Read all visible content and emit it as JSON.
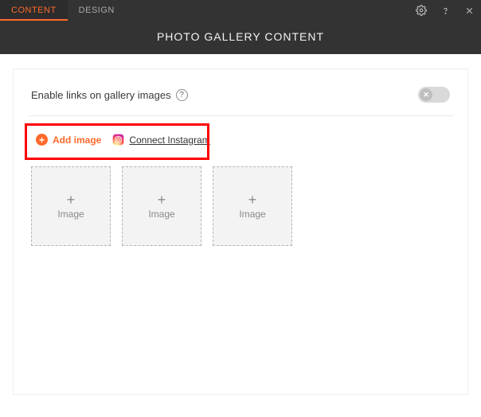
{
  "tabs": {
    "content": "CONTENT",
    "design": "DESIGN"
  },
  "title": "PHOTO GALLERY CONTENT",
  "options": {
    "enable_links_label": "Enable links on gallery images",
    "toggle_on": false
  },
  "actions": {
    "add_image_label": "Add image",
    "connect_instagram_label": "Connect Instagram"
  },
  "placeholders": {
    "image_label": "Image"
  },
  "thumbnails": [
    {
      "label_key": "placeholders.image_label"
    },
    {
      "label_key": "placeholders.image_label"
    },
    {
      "label_key": "placeholders.image_label"
    }
  ]
}
